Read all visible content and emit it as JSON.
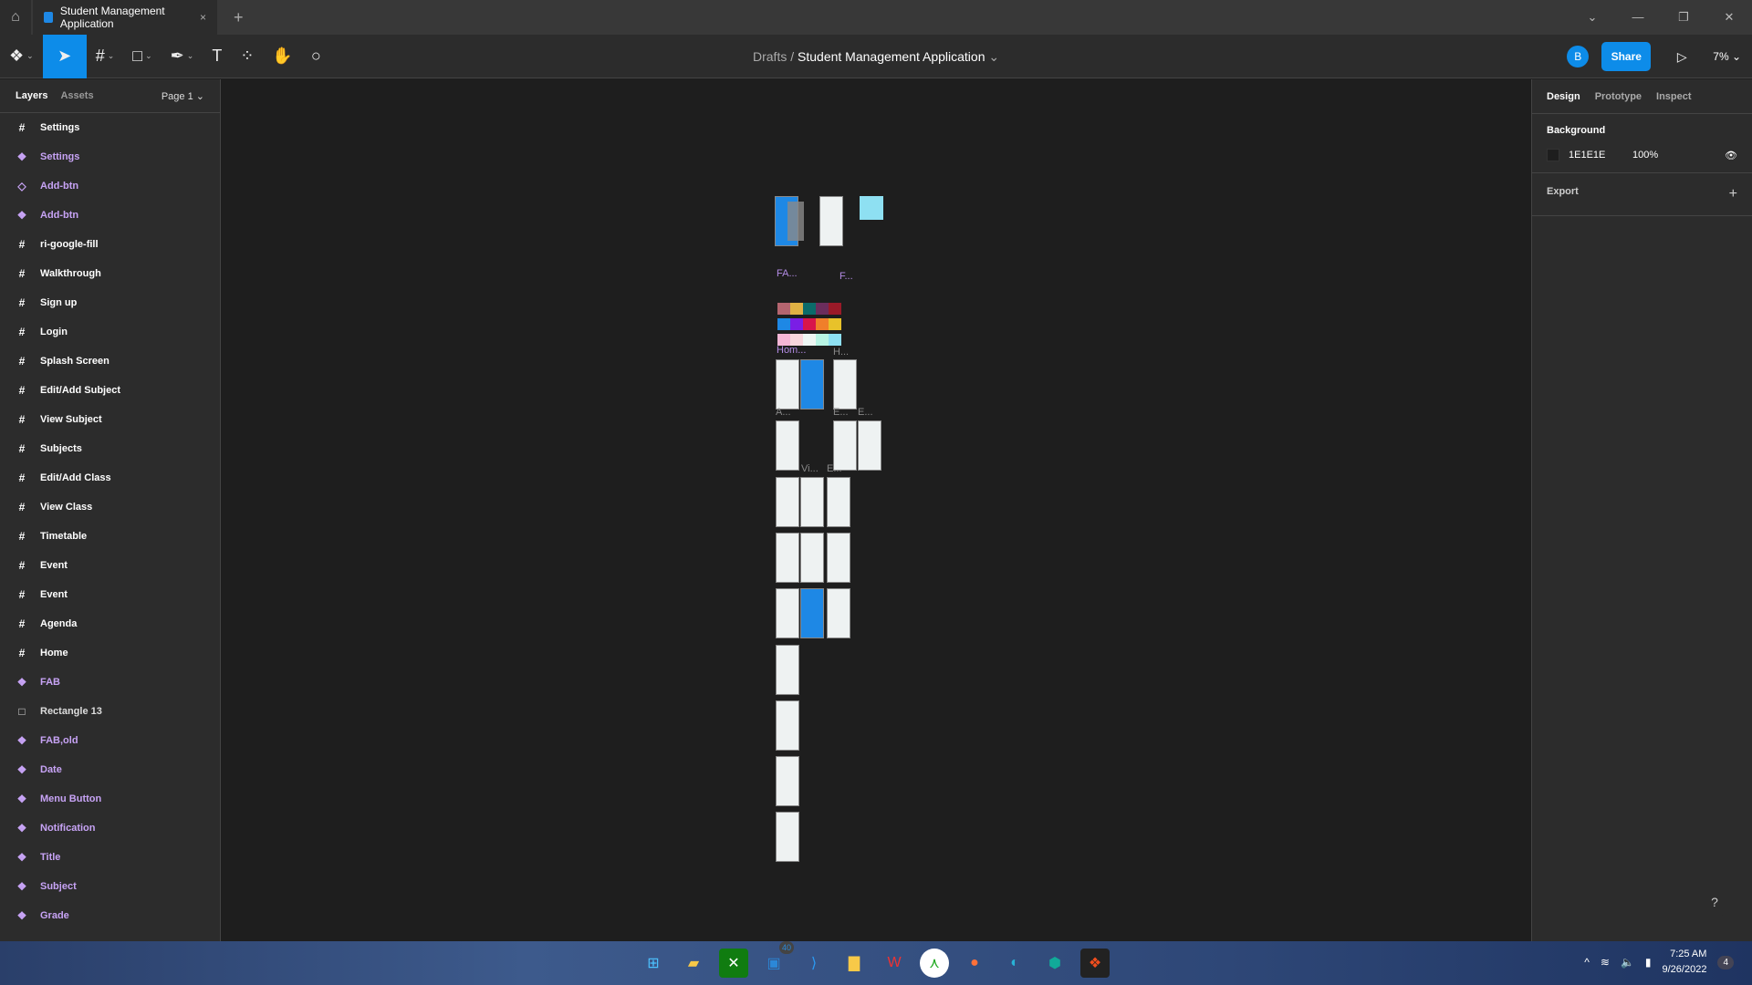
{
  "tabbar": {
    "tab_title": "Student Management Application",
    "close": "×",
    "new_tab": "+",
    "win": [
      "⌄",
      "—",
      "❐",
      "✕"
    ]
  },
  "toolbar": {
    "breadcrumb_root": "Drafts",
    "breadcrumb_sep": "/",
    "file_name": "Student Management Application",
    "avatar": "B",
    "share_label": "Share",
    "zoom": "7%"
  },
  "left": {
    "tabs": [
      "Layers",
      "Assets"
    ],
    "page": "Page 1",
    "layers": [
      {
        "label": "Settings",
        "type": "frame"
      },
      {
        "label": "Settings",
        "type": "comp"
      },
      {
        "label": "Add-btn",
        "type": "inst"
      },
      {
        "label": "Add-btn",
        "type": "comp"
      },
      {
        "label": "ri-google-fill",
        "type": "frame"
      },
      {
        "label": "Walkthrough",
        "type": "frame"
      },
      {
        "label": "Sign up",
        "type": "frame"
      },
      {
        "label": "Login",
        "type": "frame"
      },
      {
        "label": "Splash Screen",
        "type": "frame"
      },
      {
        "label": "Edit/Add Subject",
        "type": "frame"
      },
      {
        "label": "View Subject",
        "type": "frame"
      },
      {
        "label": "Subjects",
        "type": "frame"
      },
      {
        "label": "Edit/Add Class",
        "type": "frame"
      },
      {
        "label": "View Class",
        "type": "frame"
      },
      {
        "label": "Timetable",
        "type": "frame"
      },
      {
        "label": "Event",
        "type": "frame"
      },
      {
        "label": "Event",
        "type": "frame"
      },
      {
        "label": "Agenda",
        "type": "frame"
      },
      {
        "label": "Home",
        "type": "frame"
      },
      {
        "label": "FAB",
        "type": "comp"
      },
      {
        "label": "Rectangle 13",
        "type": "rect"
      },
      {
        "label": "FAB,old",
        "type": "comp"
      },
      {
        "label": "Date",
        "type": "comp"
      },
      {
        "label": "Menu Button",
        "type": "comp"
      },
      {
        "label": "Notification",
        "type": "comp"
      },
      {
        "label": "Title",
        "type": "comp"
      },
      {
        "label": "Subject",
        "type": "comp"
      },
      {
        "label": "Grade",
        "type": "comp"
      }
    ]
  },
  "right": {
    "tabs": [
      "Design",
      "Prototype",
      "Inspect"
    ],
    "background_label": "Background",
    "bg_hex": "1E1E1E",
    "bg_opacity": "100%",
    "export_label": "Export",
    "help": "?"
  },
  "canvas": {
    "labels": [
      "FA...",
      "F...",
      "Hom...",
      "H...",
      "A...",
      "E...",
      "E...",
      "Vi...",
      "E..."
    ],
    "swatches": [
      [
        "#b5656f",
        "#e0b144",
        "#0b6b6a",
        "#6b2d5c",
        "#9a1a28"
      ],
      [
        "#1e88e5",
        "#7a1ee5",
        "#d8154b",
        "#f07f2a",
        "#e8c22a"
      ],
      [
        "#f5b6d6",
        "#f8d6dd",
        "#eef6f3",
        "#b8f4e4",
        "#8ee0f2"
      ]
    ]
  },
  "taskbar": {
    "badge": "40",
    "time": "7:25 AM",
    "date": "9/26/2022",
    "notif": "4"
  }
}
